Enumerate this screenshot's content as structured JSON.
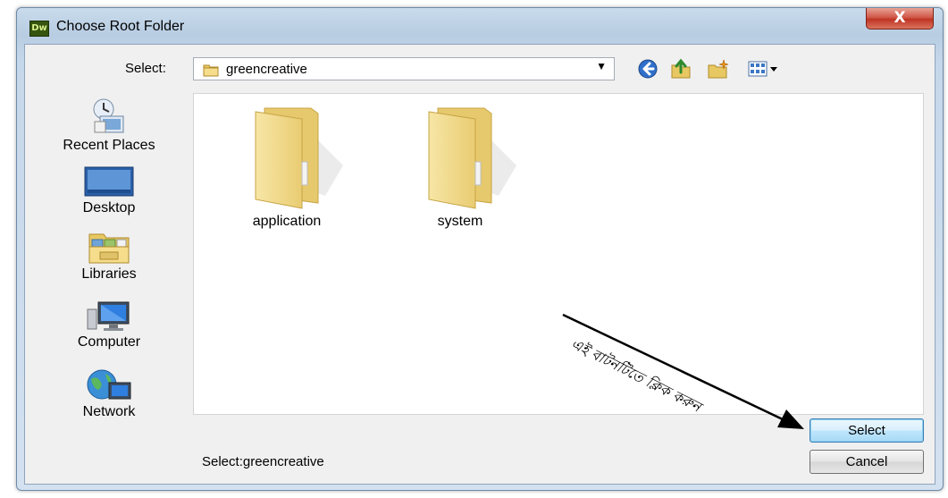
{
  "window": {
    "app_icon_text": "Dw",
    "title": "Choose Root Folder",
    "close_glyph": "X"
  },
  "select_row": {
    "label": "Select:",
    "current_path": "greencreative"
  },
  "toolbar": {
    "back_icon": "back-arrow-icon",
    "up_icon": "up-folder-icon",
    "new_folder_icon": "new-folder-icon",
    "views_icon": "view-menu-icon"
  },
  "places": [
    {
      "label": "Recent Places",
      "icon": "recent-places-icon"
    },
    {
      "label": "Desktop",
      "icon": "desktop-icon"
    },
    {
      "label": "Libraries",
      "icon": "libraries-icon"
    },
    {
      "label": "Computer",
      "icon": "computer-icon"
    },
    {
      "label": "Network",
      "icon": "network-icon"
    }
  ],
  "files": [
    {
      "name": "application",
      "icon": "folder-icon"
    },
    {
      "name": "system",
      "icon": "folder-icon"
    }
  ],
  "annotation": {
    "text": "এই বাটনটিতে ক্লিক করুন"
  },
  "status": {
    "text": "Select:greencreative"
  },
  "buttons": {
    "select_label": "Select",
    "cancel_label": "Cancel"
  },
  "colors": {
    "titlebar": "#c9dbec",
    "close_button": "#c03523",
    "default_button": "#bee6fd",
    "folder": "#f3dc8a"
  }
}
